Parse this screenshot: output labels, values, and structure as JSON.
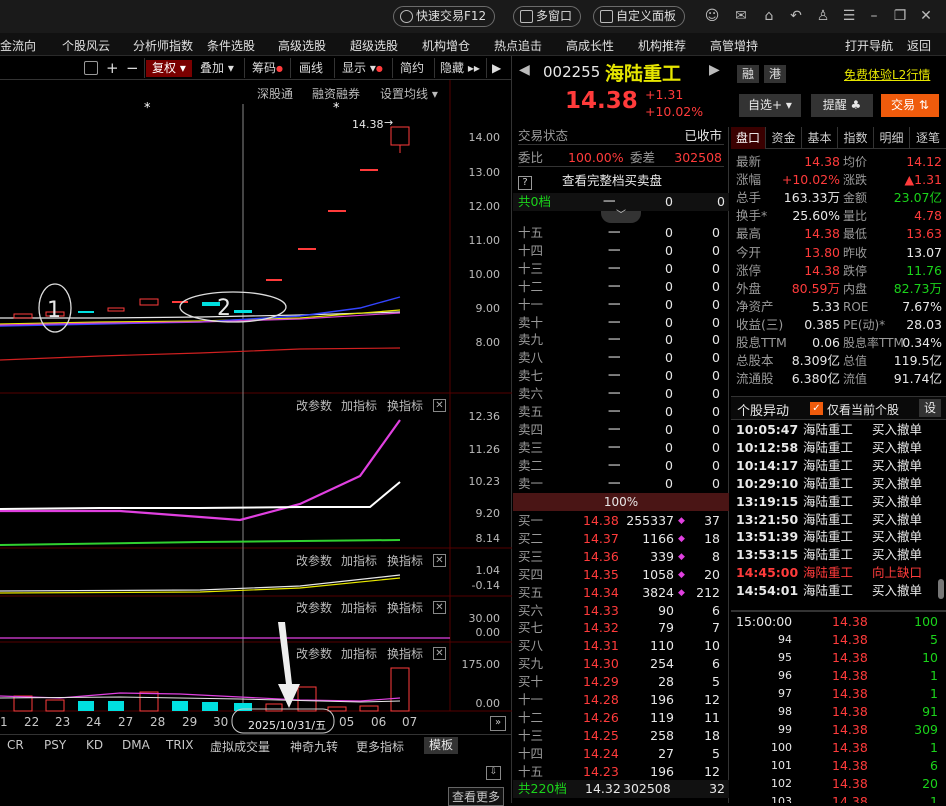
{
  "titlebar": {
    "buttons": [
      "快速交易F12",
      "多窗口",
      "自定义面板"
    ]
  },
  "menubar": {
    "items": [
      "资金流向",
      "个股风云",
      "分析师指数",
      "条件选股",
      "高级选股",
      "超级选股",
      "机构增仓",
      "热点追击",
      "高成长性",
      "机构推荐",
      "高管增持",
      "打开导航",
      "返回"
    ]
  },
  "chart_toolbar": {
    "items": [
      "复权",
      "叠加",
      "筹码",
      "画线",
      "显示",
      "简约",
      "隐藏"
    ]
  },
  "chart_sub_toolbar": [
    "深股通",
    "融资融券",
    "设置均线"
  ],
  "main_axis": [
    "14.00",
    "13.00",
    "12.00",
    "11.00",
    "10.00",
    "9.00",
    "8.00"
  ],
  "price_marker": "14.38",
  "annotations": [
    "1",
    "2"
  ],
  "panels": [
    {
      "buttons": [
        "改参数",
        "加指标",
        "换指标"
      ],
      "axis": [
        "12.36",
        "11.26",
        "10.23",
        "9.20",
        "8.14"
      ]
    },
    {
      "buttons": [
        "改参数",
        "加指标",
        "换指标"
      ],
      "axis": [
        "1.04",
        "-0.14"
      ]
    },
    {
      "buttons": [
        "改参数",
        "加指标",
        "换指标"
      ],
      "axis": [
        "30.00",
        "0.00"
      ]
    },
    {
      "buttons": [
        "改参数",
        "加指标",
        "换指标"
      ],
      "axis": [
        "175.00",
        "0.00"
      ]
    }
  ],
  "x_axis": [
    "1",
    "22",
    "23",
    "24",
    "27",
    "28",
    "29",
    "30",
    "31",
    "05",
    "06",
    "07"
  ],
  "x_cursor_label": "2025/10/31/五",
  "indicator_tabs": [
    "CR",
    "PSY",
    "KD",
    "DMA",
    "TRIX",
    "虚拟成交量",
    "神奇九转",
    "更多指标",
    "模板"
  ],
  "footer_btn": "查看更多",
  "stock": {
    "code": "002255",
    "name": "海陆重工",
    "price": "14.38",
    "change": "+1.31",
    "pct": "+10.02%",
    "tags": [
      "融",
      "港"
    ],
    "l2_link": "免费体验L2行情",
    "btn_watch": "自选+",
    "btn_alert": "提醒",
    "btn_trade": "交易"
  },
  "trade_status": {
    "label": "交易状态",
    "value": "已收市"
  },
  "weibi": {
    "label1": "委比",
    "value1": "100.00%",
    "label2": "委差",
    "value2": "302508"
  },
  "full_book": "查看完整档买卖盘",
  "total_levels": "共0档",
  "sell_levels": [
    {
      "name": "十五",
      "price": "一",
      "vol": "0",
      "cnt": "0"
    },
    {
      "name": "十四",
      "price": "一",
      "vol": "0",
      "cnt": "0"
    },
    {
      "name": "十三",
      "price": "一",
      "vol": "0",
      "cnt": "0"
    },
    {
      "name": "十二",
      "price": "一",
      "vol": "0",
      "cnt": "0"
    },
    {
      "name": "十一",
      "price": "一",
      "vol": "0",
      "cnt": "0"
    },
    {
      "name": "卖十",
      "price": "一",
      "vol": "0",
      "cnt": "0"
    },
    {
      "name": "卖九",
      "price": "一",
      "vol": "0",
      "cnt": "0"
    },
    {
      "name": "卖八",
      "price": "一",
      "vol": "0",
      "cnt": "0"
    },
    {
      "name": "卖七",
      "price": "一",
      "vol": "0",
      "cnt": "0"
    },
    {
      "name": "卖六",
      "price": "一",
      "vol": "0",
      "cnt": "0"
    },
    {
      "name": "卖五",
      "price": "一",
      "vol": "0",
      "cnt": "0"
    },
    {
      "name": "卖四",
      "price": "一",
      "vol": "0",
      "cnt": "0"
    },
    {
      "name": "卖三",
      "price": "一",
      "vol": "0",
      "cnt": "0"
    },
    {
      "name": "卖二",
      "price": "一",
      "vol": "0",
      "cnt": "0"
    },
    {
      "name": "卖一",
      "price": "一",
      "vol": "0",
      "cnt": "0"
    }
  ],
  "book_ratio": "100%",
  "buy_levels": [
    {
      "name": "买一",
      "price": "14.38",
      "vol": "255337",
      "cnt": "37",
      "dot": true
    },
    {
      "name": "买二",
      "price": "14.37",
      "vol": "1166",
      "cnt": "18",
      "dot": true
    },
    {
      "name": "买三",
      "price": "14.36",
      "vol": "339",
      "cnt": "8",
      "dot": true
    },
    {
      "name": "买四",
      "price": "14.35",
      "vol": "1058",
      "cnt": "20",
      "dot": true
    },
    {
      "name": "买五",
      "price": "14.34",
      "vol": "3824",
      "cnt": "212",
      "dot": true
    },
    {
      "name": "买六",
      "price": "14.33",
      "vol": "90",
      "cnt": "6",
      "dot": false
    },
    {
      "name": "买七",
      "price": "14.32",
      "vol": "79",
      "cnt": "7",
      "dot": false
    },
    {
      "name": "买八",
      "price": "14.31",
      "vol": "110",
      "cnt": "10",
      "dot": false
    },
    {
      "name": "买九",
      "price": "14.30",
      "vol": "254",
      "cnt": "6",
      "dot": false
    },
    {
      "name": "买十",
      "price": "14.29",
      "vol": "28",
      "cnt": "5",
      "dot": false
    },
    {
      "name": "十一",
      "price": "14.28",
      "vol": "196",
      "cnt": "12",
      "dot": false
    },
    {
      "name": "十二",
      "price": "14.26",
      "vol": "119",
      "cnt": "11",
      "dot": false
    },
    {
      "name": "十三",
      "price": "14.25",
      "vol": "258",
      "cnt": "18",
      "dot": false
    },
    {
      "name": "十四",
      "price": "14.24",
      "vol": "27",
      "cnt": "5",
      "dot": false
    },
    {
      "name": "十五",
      "price": "14.23",
      "vol": "196",
      "cnt": "12",
      "dot": false
    }
  ],
  "book_footer": {
    "label": "共220档",
    "price": "14.32",
    "vol": "302508",
    "cnt": "32"
  },
  "quote_tabs": [
    "盘口",
    "资金",
    "基本",
    "指数",
    "明细",
    "逐笔"
  ],
  "quote": [
    {
      "l1": "最新",
      "v1": "14.38",
      "c1": "red",
      "l2": "均价",
      "v2": "14.12",
      "c2": "red"
    },
    {
      "l1": "涨幅",
      "v1": "+10.02%",
      "c1": "red",
      "l2": "涨跌",
      "v2": "▲1.31",
      "c2": "red"
    },
    {
      "l1": "总手",
      "v1": "163.33万",
      "c1": "wht",
      "l2": "金额",
      "v2": "23.07亿",
      "c2": "grn"
    },
    {
      "l1": "换手*",
      "v1": "25.60%",
      "c1": "wht",
      "l2": "量比",
      "v2": "4.78",
      "c2": "red"
    },
    {
      "l1": "最高",
      "v1": "14.38",
      "c1": "red",
      "l2": "最低",
      "v2": "13.63",
      "c2": "red"
    },
    {
      "l1": "今开",
      "v1": "13.80",
      "c1": "red",
      "l2": "昨收",
      "v2": "13.07",
      "c2": "wht"
    },
    {
      "l1": "涨停",
      "v1": "14.38",
      "c1": "red",
      "l2": "跌停",
      "v2": "11.76",
      "c2": "grn"
    },
    {
      "l1": "外盘",
      "v1": "80.59万",
      "c1": "red",
      "l2": "内盘",
      "v2": "82.73万",
      "c2": "grn"
    },
    {
      "l1": "净资产",
      "v1": "5.33",
      "c1": "wht",
      "l2": "ROE",
      "v2": "7.67%",
      "c2": "wht"
    },
    {
      "l1": "收益(三)",
      "v1": "0.385",
      "c1": "wht",
      "l2": "PE(动)*",
      "v2": "28.03",
      "c2": "wht"
    },
    {
      "l1": "股息TTM",
      "v1": "0.06",
      "c1": "wht",
      "l2": "股息率TTM",
      "v2": "0.34%",
      "c2": "wht"
    },
    {
      "l1": "总股本",
      "v1": "8.309亿",
      "c1": "wht",
      "l2": "总值",
      "v2": "119.5亿",
      "c2": "wht"
    },
    {
      "l1": "流通股",
      "v1": "6.380亿",
      "c1": "wht",
      "l2": "流值",
      "v2": "91.74亿",
      "c2": "wht"
    }
  ],
  "anomaly": {
    "title": "个股异动",
    "checkbox": "仅看当前个股",
    "settings": "设",
    "rows": [
      {
        "time": "10:05:47",
        "name": "海陆重工",
        "event": "买入撤单",
        "hl": false
      },
      {
        "time": "10:12:58",
        "name": "海陆重工",
        "event": "买入撤单",
        "hl": false
      },
      {
        "time": "10:14:17",
        "name": "海陆重工",
        "event": "买入撤单",
        "hl": false
      },
      {
        "time": "10:29:10",
        "name": "海陆重工",
        "event": "买入撤单",
        "hl": false
      },
      {
        "time": "13:19:15",
        "name": "海陆重工",
        "event": "买入撤单",
        "hl": false
      },
      {
        "time": "13:21:50",
        "name": "海陆重工",
        "event": "买入撤单",
        "hl": false
      },
      {
        "time": "13:51:39",
        "name": "海陆重工",
        "event": "买入撤单",
        "hl": false
      },
      {
        "time": "13:53:15",
        "name": "海陆重工",
        "event": "买入撤单",
        "hl": false
      },
      {
        "time": "14:45:00",
        "name": "海陆重工",
        "event": "向上缺口",
        "hl": true
      },
      {
        "time": "14:54:01",
        "name": "海陆重工",
        "event": "买入撤单",
        "hl": false
      }
    ]
  },
  "ticks": [
    {
      "t": "15:00:00",
      "p": "14.38",
      "v": "100"
    },
    {
      "t": "94",
      "p": "14.38",
      "v": "5"
    },
    {
      "t": "95",
      "p": "14.38",
      "v": "10"
    },
    {
      "t": "96",
      "p": "14.38",
      "v": "1"
    },
    {
      "t": "97",
      "p": "14.38",
      "v": "1"
    },
    {
      "t": "98",
      "p": "14.38",
      "v": "91"
    },
    {
      "t": "99",
      "p": "14.38",
      "v": "309"
    },
    {
      "t": "100",
      "p": "14.38",
      "v": "1"
    },
    {
      "t": "101",
      "p": "14.38",
      "v": "6"
    },
    {
      "t": "102",
      "p": "14.38",
      "v": "20"
    },
    {
      "t": "103",
      "p": "14.38",
      "v": "1"
    }
  ]
}
